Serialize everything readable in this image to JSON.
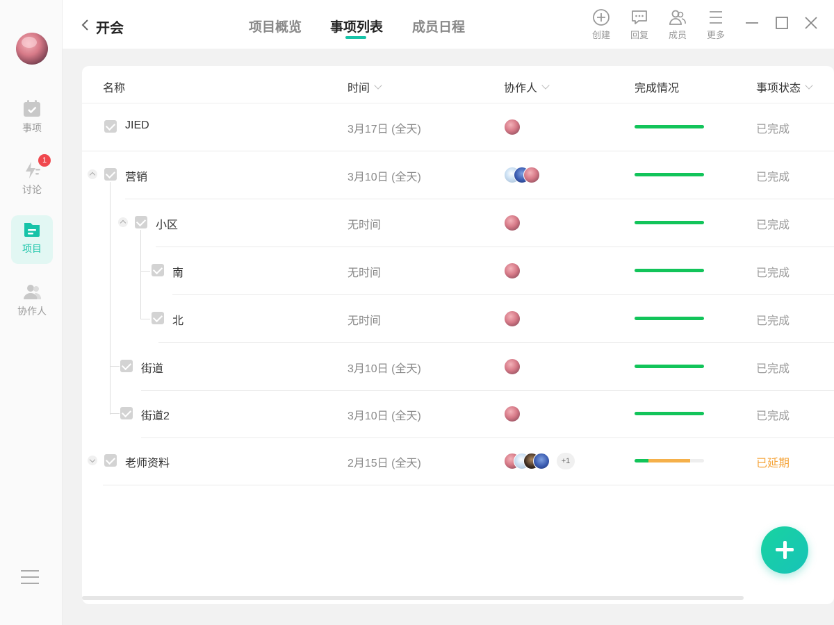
{
  "sidebar": {
    "items": [
      {
        "label": "事项",
        "icon": "calendar-check-icon"
      },
      {
        "label": "讨论",
        "icon": "lightning-icon",
        "badge": "1"
      },
      {
        "label": "项目",
        "icon": "folder-icon",
        "active": true
      },
      {
        "label": "协作人",
        "icon": "people-icon"
      }
    ]
  },
  "header": {
    "title": "开会",
    "tabs": [
      {
        "label": "项目概览"
      },
      {
        "label": "事项列表",
        "active": true
      },
      {
        "label": "成员日程"
      }
    ],
    "tools": [
      {
        "label": "创建",
        "icon": "plus-circle-icon"
      },
      {
        "label": "回复",
        "icon": "chat-icon"
      },
      {
        "label": "成员",
        "icon": "members-icon"
      },
      {
        "label": "更多",
        "icon": "menu-icon"
      }
    ]
  },
  "table": {
    "columns": [
      "名称",
      "时间",
      "协作人",
      "完成情况",
      "事项状态"
    ],
    "rows": [
      {
        "name": "JIED",
        "time": "3月17日 (全天)",
        "status": "已完成",
        "progress": 1.0
      },
      {
        "name": "营销",
        "time": "3月10日 (全天)",
        "status": "已完成",
        "progress": 1.0
      },
      {
        "name": "小区",
        "time": "无时间",
        "status": "已完成",
        "progress": 1.0
      },
      {
        "name": "南",
        "time": "无时间",
        "status": "已完成",
        "progress": 1.0
      },
      {
        "name": "北",
        "time": "无时间",
        "status": "已完成",
        "progress": 1.0
      },
      {
        "name": "街道",
        "time": "3月10日 (全天)",
        "status": "已完成",
        "progress": 1.0
      },
      {
        "name": "街道2",
        "time": "3月10日 (全天)",
        "status": "已完成",
        "progress": 1.0
      },
      {
        "name": "老师资料",
        "time": "2月15日 (全天)",
        "status": "已延期",
        "progress_done": 0.2,
        "progress_delayed": 0.6,
        "extra_members": "+1"
      }
    ]
  },
  "colors": {
    "accent": "#17c3a8",
    "progress_green": "#12c45a",
    "progress_orange": "#f5b04a",
    "status_delayed": "#f5a43a",
    "badge_red": "#f0484e"
  }
}
